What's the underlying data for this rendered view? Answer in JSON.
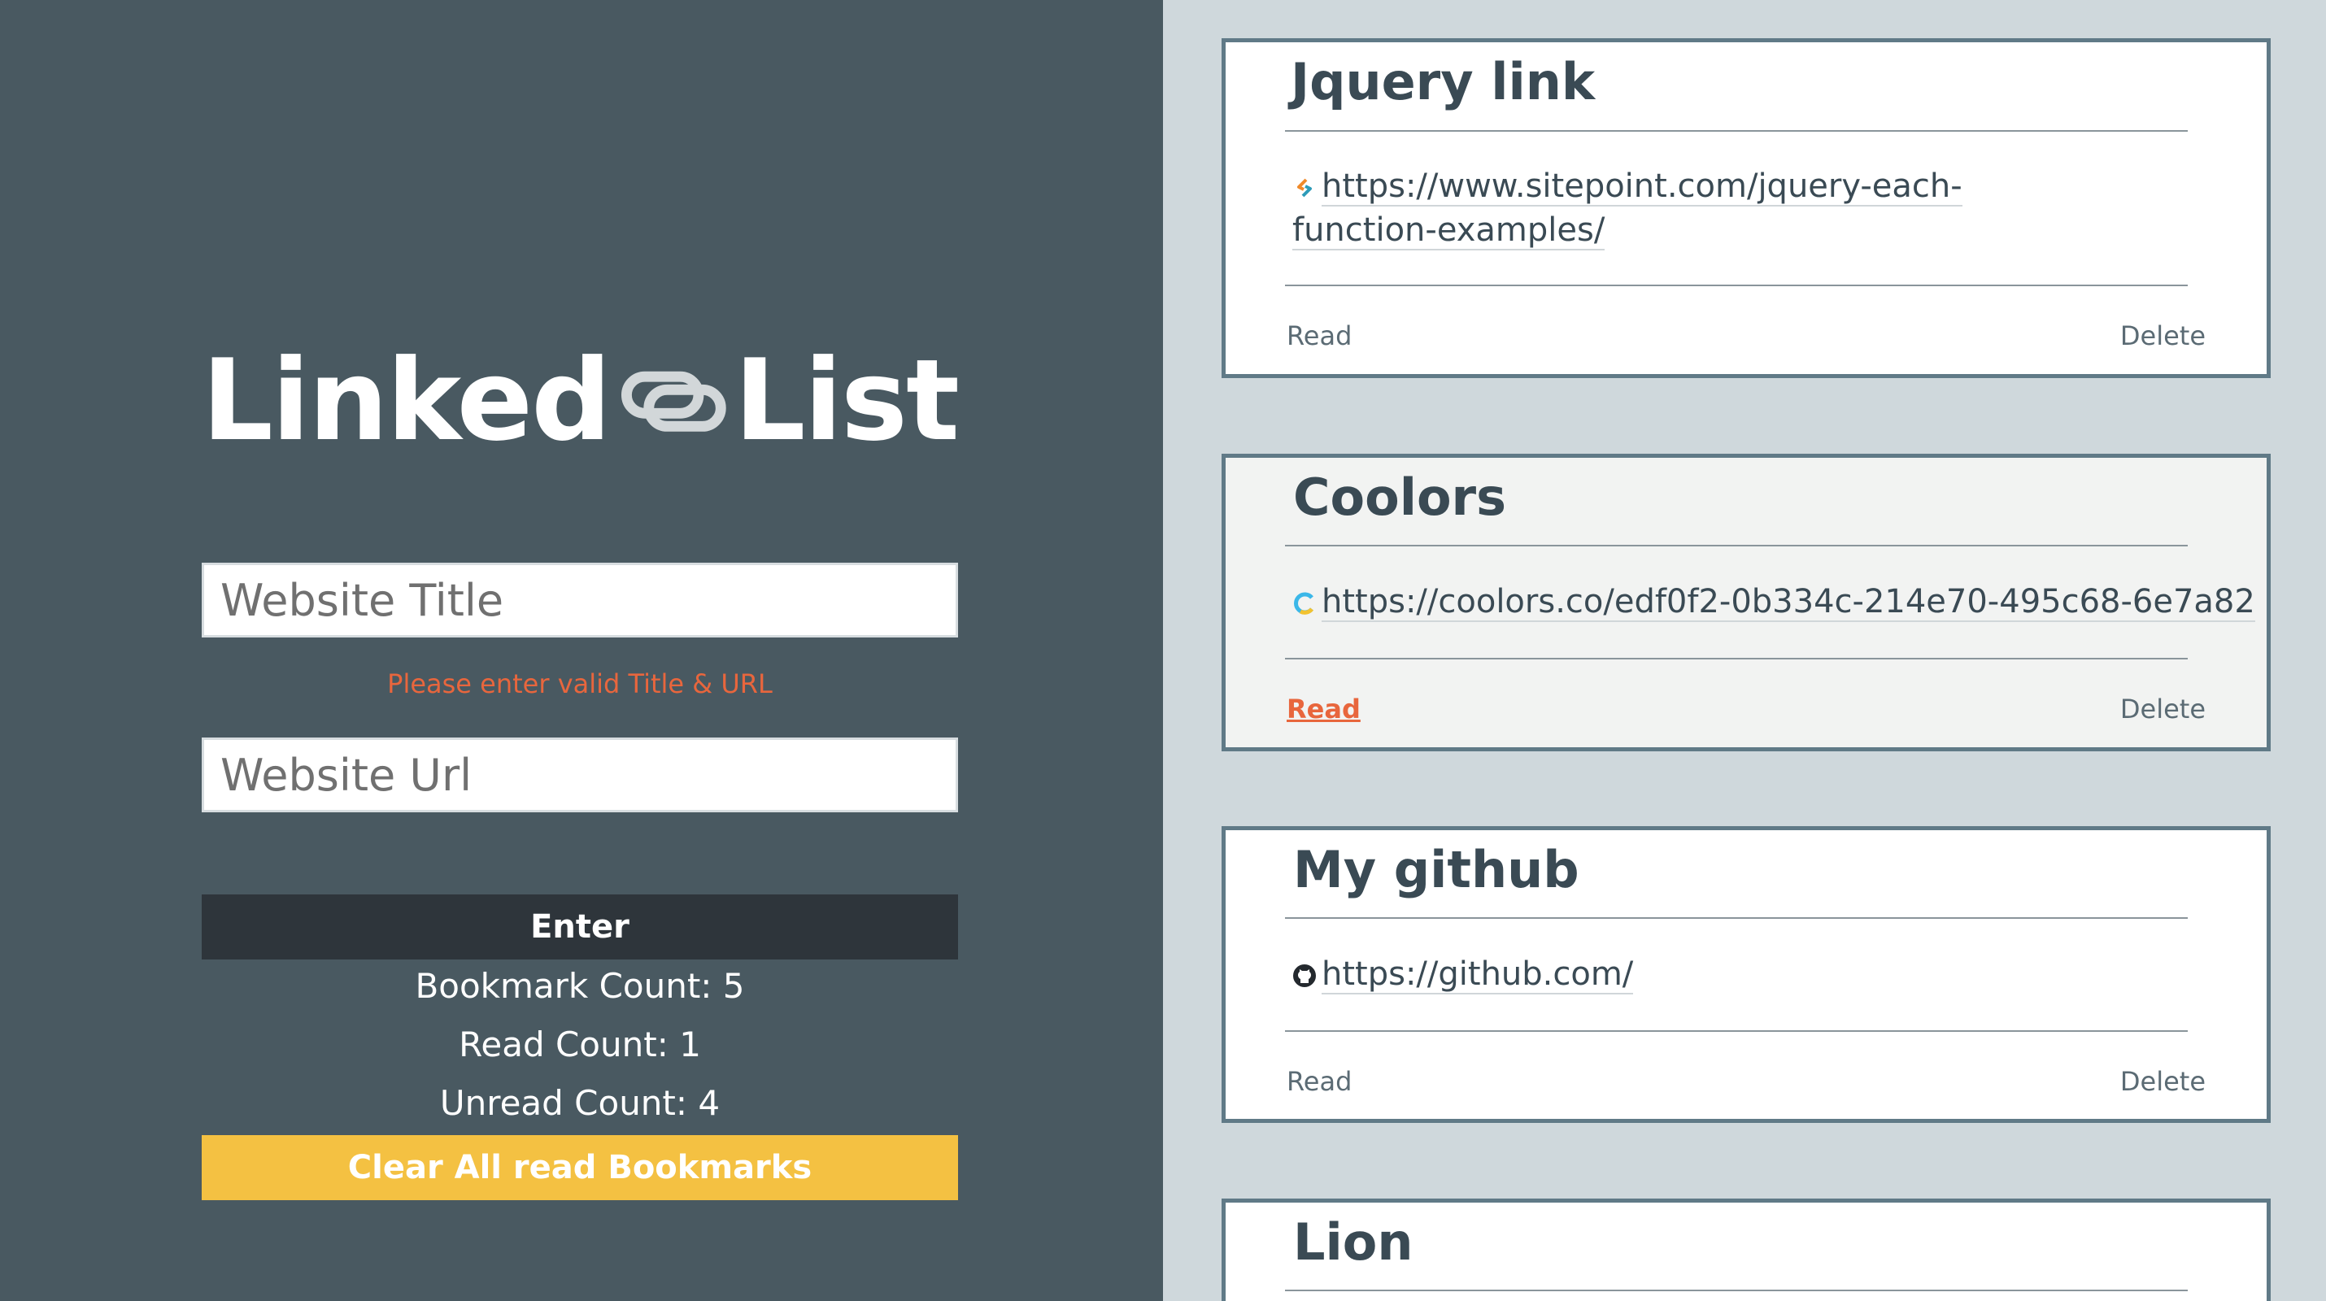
{
  "app": {
    "logo_left": "Linked",
    "logo_right": "List",
    "colors": {
      "left_panel_bg": "#495961",
      "right_panel_bg": "#cfd8dc",
      "enter_button_bg": "#2e353b",
      "clear_button_bg": "#f4c142",
      "error_text": "#e8663d",
      "card_border": "#607a87"
    }
  },
  "form": {
    "title_placeholder": "Website Title",
    "title_value": "",
    "url_placeholder": "Website Url",
    "url_value": "",
    "error_message": "Please enter valid Title & URL",
    "enter_label": "Enter"
  },
  "counts": {
    "bookmark": "Bookmark Count: 5",
    "read": "Read Count: 1",
    "unread": "Unread Count: 4"
  },
  "clear_label": "Clear All read Bookmarks",
  "bookmarks": [
    {
      "title": "Jquery link",
      "url": "https://www.sitepoint.com/jquery-each-function-examples/",
      "favicon": "sitepoint-icon",
      "read": false,
      "read_label": "Read",
      "delete_label": "Delete"
    },
    {
      "title": "Coolors",
      "url": "https://coolors.co/edf0f2-0b334c-214e70-495c68-6e7a82",
      "favicon": "coolors-icon",
      "read": true,
      "read_label": "Read",
      "delete_label": "Delete"
    },
    {
      "title": "My github",
      "url": "https://github.com/",
      "favicon": "github-icon",
      "read": false,
      "read_label": "Read",
      "delete_label": "Delete"
    },
    {
      "title": "Lion"
    }
  ]
}
